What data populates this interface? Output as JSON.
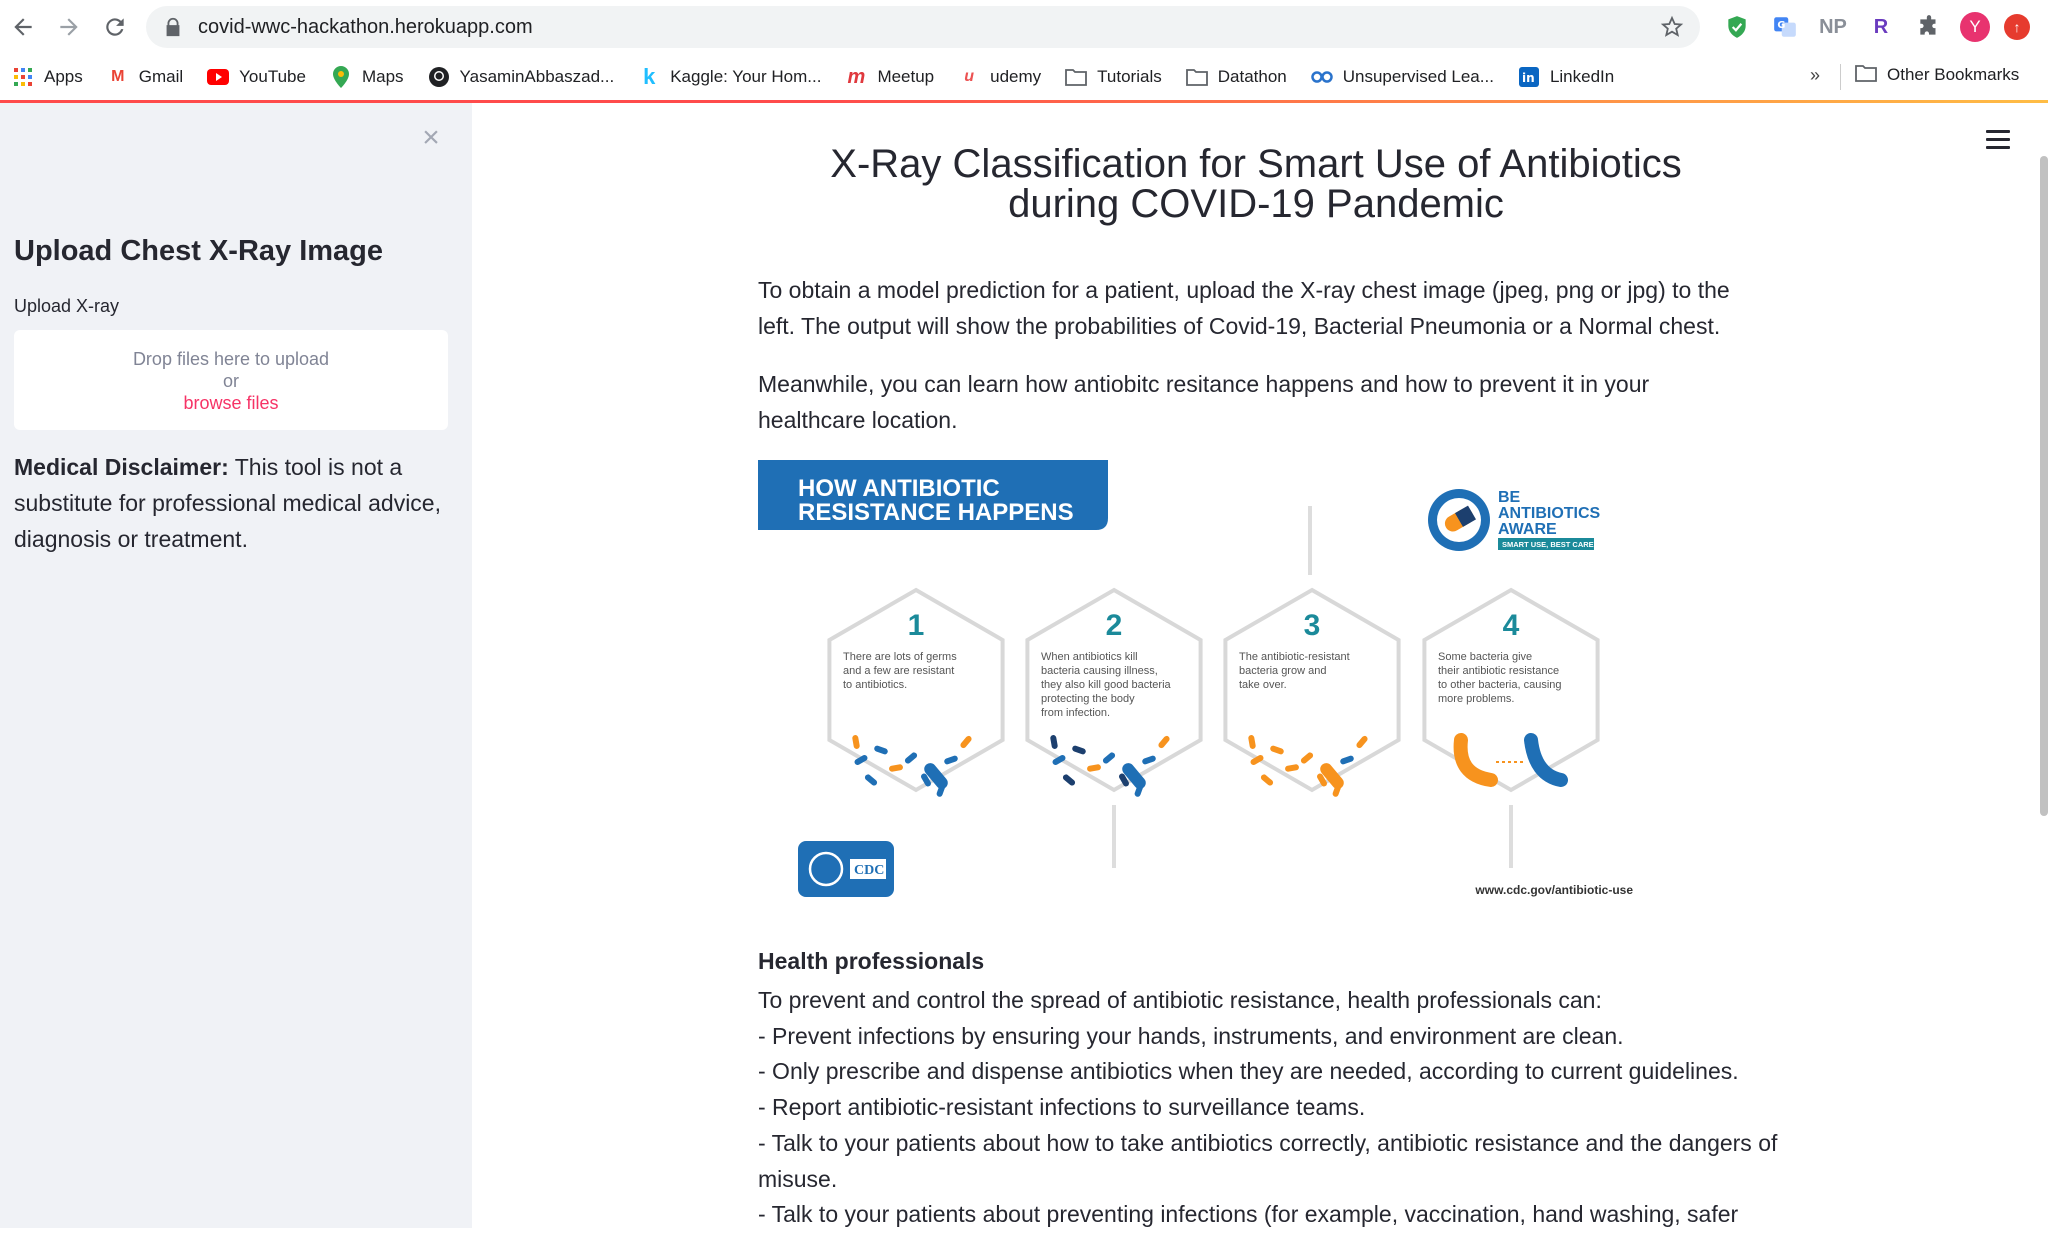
{
  "browser": {
    "url": "covid-wwc-hackathon.herokuapp.com",
    "avatar_letter": "Y",
    "ext_np": "NP",
    "ext_r": "R",
    "bookmarks": [
      {
        "label": "Apps",
        "icon": "apps-grid-icon"
      },
      {
        "label": "Gmail",
        "icon": "gmail-icon"
      },
      {
        "label": "YouTube",
        "icon": "youtube-icon"
      },
      {
        "label": "Maps",
        "icon": "maps-icon"
      },
      {
        "label": "YasaminAbbaszad...",
        "icon": "github-icon"
      },
      {
        "label": "Kaggle: Your Hom...",
        "icon": "kaggle-icon"
      },
      {
        "label": "Meetup",
        "icon": "meetup-icon"
      },
      {
        "label": "udemy",
        "icon": "udemy-icon"
      },
      {
        "label": "Tutorials",
        "icon": "folder-icon"
      },
      {
        "label": "Datathon",
        "icon": "folder-icon"
      },
      {
        "label": "Unsupervised Lea...",
        "icon": "coursera-icon"
      },
      {
        "label": "LinkedIn",
        "icon": "linkedin-icon"
      }
    ],
    "more": "»",
    "other_bookmarks": "Other Bookmarks"
  },
  "sidebar": {
    "heading": "Upload Chest X-Ray Image",
    "upload_label": "Upload X-ray",
    "drop_text": "Drop files here to upload",
    "or_text": "or",
    "browse_text": "browse files",
    "disclaimer_bold": "Medical Disclaimer:",
    "disclaimer_text": " This tool is not a substitute for professional medical advice, diagnosis or treatment."
  },
  "main": {
    "title_line1": "X-Ray Classification for Smart Use of Antibiotics",
    "title_line2": "during COVID-19 Pandemic",
    "para1": "To obtain a model prediction for a patient, upload the X-ray chest image (jpeg, png or jpg) to the left. The output will show the probabilities of Covid-19, Bacterial Pneumonia or a Normal chest.",
    "para2": "Meanwhile, you can learn how antiobitc resitance happens and how to prevent it in your healthcare location.",
    "infographic": {
      "banner_line1": "HOW ANTIBIOTIC",
      "banner_line2": "RESISTANCE HAPPENS",
      "aware_be": "BE",
      "aware_line2": "ANTIBIOTICS",
      "aware_line3": "AWARE",
      "aware_tag": "SMART USE, BEST CARE",
      "cdc": "CDC",
      "url": "www.cdc.gov/antibiotic-use",
      "steps": [
        {
          "num": "1",
          "lines": [
            "There are lots of germs",
            "and a few are resistant",
            "to antibiotics."
          ]
        },
        {
          "num": "2",
          "lines": [
            "When antibiotics kill",
            "bacteria causing illness,",
            "they also kill good bacteria",
            "protecting the body",
            "from infection."
          ]
        },
        {
          "num": "3",
          "lines": [
            "The antibiotic-resistant",
            "bacteria grow and",
            "take over."
          ]
        },
        {
          "num": "4",
          "lines": [
            "Some bacteria give",
            "their antibiotic resistance",
            "to other bacteria, causing",
            "more problems."
          ]
        }
      ],
      "colors": {
        "blue": "#1f6fb5",
        "orange": "#f7931e",
        "teal": "#1b8a9a",
        "dark": "#1c3f6e"
      }
    },
    "hp_title": "Health professionals",
    "hp_lines": [
      "To prevent and control the spread of antibiotic resistance, health professionals can:",
      "- Prevent infections by ensuring your hands, instruments, and environment are clean.",
      "- Only prescribe and dispense antibiotics when they are needed, according to current guidelines.",
      "- Report antibiotic-resistant infections to surveillance teams.",
      "- Talk to your patients about how to take antibiotics correctly, antibiotic resistance and the dangers of misuse.",
      "- Talk to your patients about preventing infections (for example, vaccination, hand washing, safer"
    ]
  }
}
